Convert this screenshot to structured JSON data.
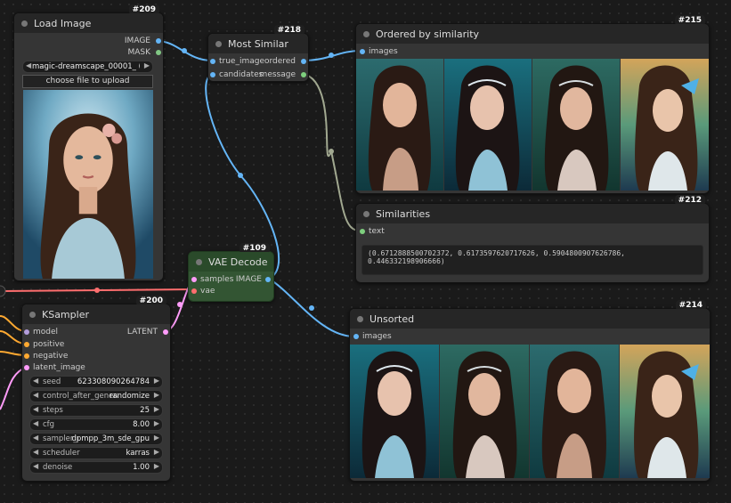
{
  "nodes": {
    "load_image": {
      "id": "#209",
      "title": "Load Image",
      "out_image": "IMAGE",
      "out_mask": "MASK",
      "image_file": "magic-dreamscape_00001_ (1).png",
      "upload_label": "choose file to upload"
    },
    "most_similar": {
      "id": "#218",
      "title": "Most Similar",
      "in_true_image": "true_image",
      "in_candidates": "candidates",
      "out_ordered": "ordered",
      "out_message": "message"
    },
    "ordered": {
      "id": "#215",
      "title": "Ordered by similarity",
      "in_images": "images"
    },
    "similarities": {
      "id": "#212",
      "title": "Similarities",
      "in_text": "text",
      "text_value": "(0.6712888500702372, 0.6173597620717626, 0.5904800907626786, 0.446332198906666)"
    },
    "vae_decode": {
      "id": "#109",
      "title": "VAE Decode",
      "in_samples": "samples",
      "in_vae": "vae",
      "out_image": "IMAGE"
    },
    "ksampler": {
      "id": "#200",
      "title": "KSampler",
      "in_model": "model",
      "in_positive": "positive",
      "in_negative": "negative",
      "in_latent": "latent_image",
      "out_latent": "LATENT",
      "widgets": [
        {
          "label": "seed",
          "value": "623308090264784"
        },
        {
          "label": "control_after_generate",
          "value": "randomize"
        },
        {
          "label": "steps",
          "value": "25"
        },
        {
          "label": "cfg",
          "value": "8.00"
        },
        {
          "label": "sampler_name",
          "value": "dpmpp_3m_sde_gpu"
        },
        {
          "label": "scheduler",
          "value": "karras"
        },
        {
          "label": "denoise",
          "value": "1.00"
        }
      ]
    },
    "unsorted": {
      "id": "#214",
      "title": "Unsorted",
      "in_images": "images"
    }
  },
  "colors": {
    "image_wire": "#64b5f6",
    "string_wire": "#a1a890",
    "latent_wire": "#ff9cf9",
    "vae_wire": "#ff6e6e",
    "conditioning_wire": "#ffa931",
    "vae_node_bg": "#335533",
    "text_slot": "#7ecf7e"
  }
}
